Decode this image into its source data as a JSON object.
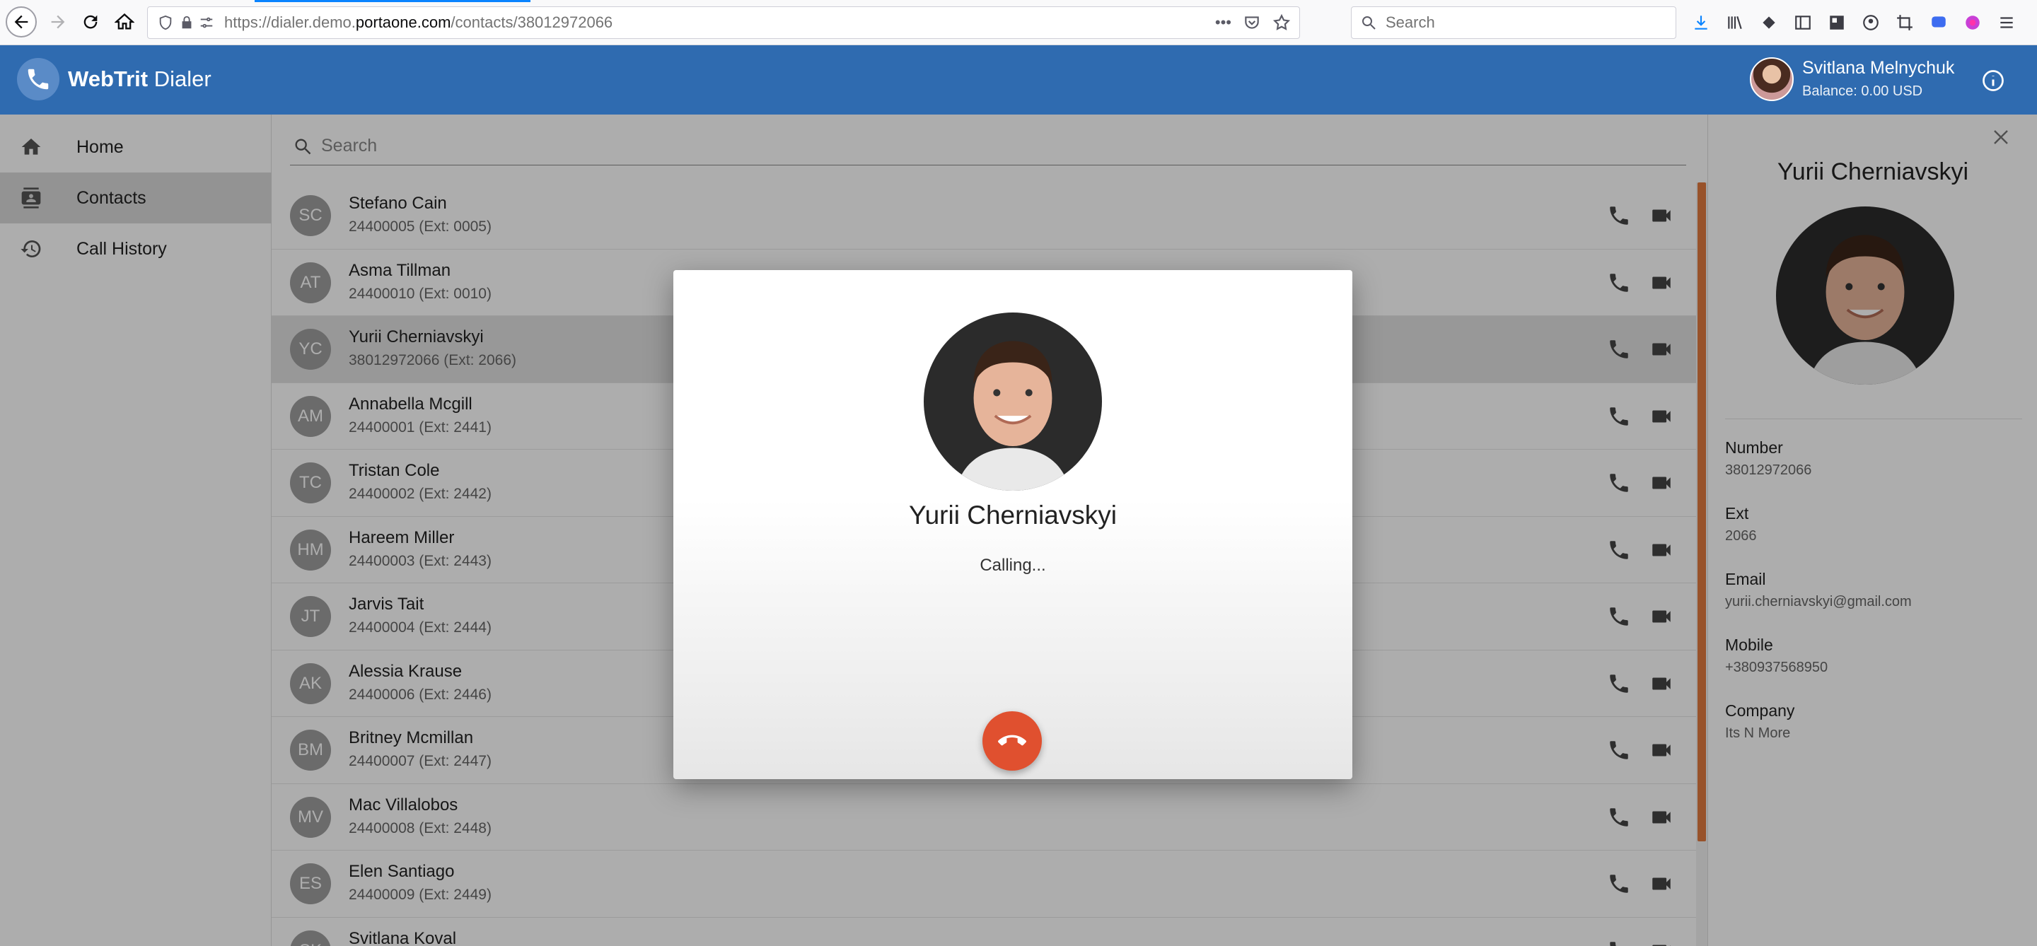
{
  "browser": {
    "url_prefix": "https://dialer.demo.",
    "url_domain": "portaone.com",
    "url_path": "/contacts/38012972066",
    "url_more": "•••",
    "search_placeholder": "Search"
  },
  "app": {
    "title_bold": "WebTrit",
    "title_rest": " Dialer",
    "user_name": "Svitlana Melnychuk",
    "balance": "Balance: 0.00 USD",
    "brand_color": "#2f6bb0"
  },
  "sidebar": {
    "items": [
      {
        "label": "Home",
        "icon": "home-icon"
      },
      {
        "label": "Contacts",
        "icon": "contacts-icon",
        "active": true
      },
      {
        "label": "Call History",
        "icon": "history-icon"
      }
    ]
  },
  "contacts": {
    "search_placeholder": "Search",
    "rows": [
      {
        "initials": "SC",
        "name": "Stefano Cain",
        "sub": "24400005 (Ext: 0005)"
      },
      {
        "initials": "AT",
        "name": "Asma Tillman",
        "sub": "24400010 (Ext: 0010)"
      },
      {
        "initials": "YC",
        "name": "Yurii Cherniavskyi",
        "sub": "38012972066 (Ext: 2066)",
        "selected": true
      },
      {
        "initials": "AM",
        "name": "Annabella Mcgill",
        "sub": "24400001 (Ext: 2441)"
      },
      {
        "initials": "TC",
        "name": "Tristan Cole",
        "sub": "24400002 (Ext: 2442)"
      },
      {
        "initials": "HM",
        "name": "Hareem Miller",
        "sub": "24400003 (Ext: 2443)"
      },
      {
        "initials": "JT",
        "name": "Jarvis Tait",
        "sub": "24400004 (Ext: 2444)"
      },
      {
        "initials": "AK",
        "name": "Alessia Krause",
        "sub": "24400006 (Ext: 2446)"
      },
      {
        "initials": "BM",
        "name": "Britney Mcmillan",
        "sub": "24400007 (Ext: 2447)"
      },
      {
        "initials": "MV",
        "name": "Mac Villalobos",
        "sub": "24400008 (Ext: 2448)"
      },
      {
        "initials": "ES",
        "name": "Elen Santiago",
        "sub": "24400009 (Ext: 2449)"
      },
      {
        "initials": "SK",
        "name": "Svitlana Koval",
        "sub": ""
      }
    ]
  },
  "detail": {
    "name": "Yurii Cherniavskyi",
    "fields": [
      {
        "label": "Number",
        "value": "38012972066"
      },
      {
        "label": "Ext",
        "value": "2066"
      },
      {
        "label": "Email",
        "value": "yurii.cherniavskyi@gmail.com"
      },
      {
        "label": "Mobile",
        "value": "+380937568950"
      },
      {
        "label": "Company",
        "value": "Its N More"
      }
    ]
  },
  "call_modal": {
    "name": "Yurii Cherniavskyi",
    "status": "Calling...",
    "hangup_color": "#e0502f"
  }
}
